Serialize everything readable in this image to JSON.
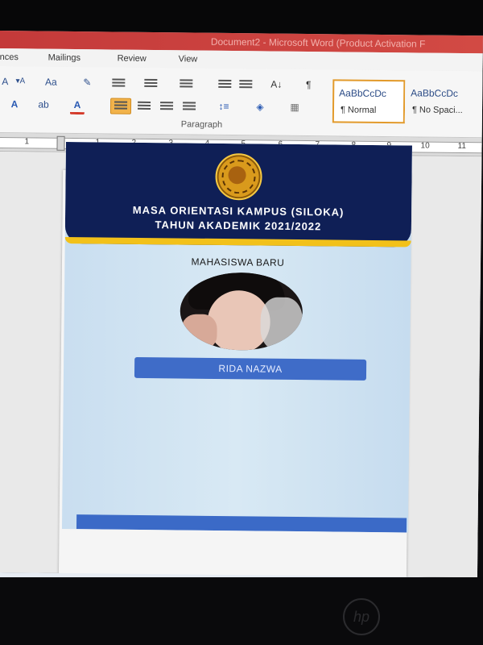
{
  "window": {
    "title": "Document2 - Microsoft Word (Product Activation F"
  },
  "ribbon": {
    "tabs": [
      "nces",
      "Mailings",
      "Review",
      "View"
    ],
    "paragraph_group_label": "Paragraph",
    "styles": [
      {
        "sample": "AaBbCcDc",
        "name": "¶ Normal"
      },
      {
        "sample": "AaBbCcDc",
        "name": "¶ No Spaci..."
      }
    ]
  },
  "ruler": {
    "numbers": [
      "1",
      "1",
      "2",
      "3",
      "4",
      "5",
      "6",
      "7",
      "8",
      "9",
      "10",
      "11"
    ]
  },
  "card": {
    "title_line1": "MASA ORIENTASI  KAMPUS (SILOKA)",
    "title_line2": "TAHUN AKADEMIK 2021/2022",
    "role": "MAHASISWA BARU",
    "name": "RIDA NAZWA",
    "colors": {
      "header": "#0f1f56",
      "gold": "#f2c11a",
      "name_bar": "#3f6cc8",
      "background": "#cfe2f1"
    }
  },
  "taskbar": {
    "icons": [
      "search-circle-icon",
      "task-view-icon",
      "edge-icon",
      "file-explorer-icon",
      "store-icon",
      "firefox-icon",
      "chrome-icon",
      "photoshop-icon",
      "word-icon"
    ]
  },
  "monitor": {
    "brand": "hp"
  }
}
